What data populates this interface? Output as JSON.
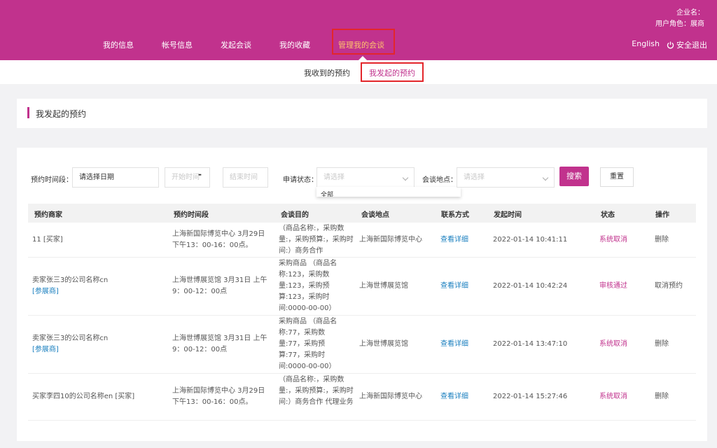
{
  "header": {
    "company_label": "企业名：",
    "role_label": "用户角色：展商",
    "nav": [
      {
        "label": "我的信息"
      },
      {
        "label": "帐号信息"
      },
      {
        "label": "发起会谈"
      },
      {
        "label": "我的收藏"
      },
      {
        "label": "管理我的会谈"
      }
    ],
    "language": "English",
    "logout": "安全退出"
  },
  "subnav": {
    "received": "我收到的预约",
    "initiated": "我发起的预约"
  },
  "section": {
    "title": "我发起的预约"
  },
  "filters": {
    "period_label": "预约时间段：",
    "date_select": "请选择日期",
    "start_placeholder": "开始时间",
    "end_placeholder": "结束时间",
    "dash": "-",
    "status_label": "申请状态：",
    "status_placeholder": "请选择",
    "location_label": "会谈地点：",
    "location_placeholder": "请选择",
    "dropdown_peek": "全部",
    "search_button": "搜索",
    "reset_button": "重置"
  },
  "table": {
    "columns": [
      "预约商家",
      "预约时间段",
      "会谈目的",
      "会谈地点",
      "联系方式",
      "发起时间",
      "状态",
      "操作"
    ],
    "rows": [
      {
        "merchant": "11 [买家]",
        "merchant_tag": "",
        "period": "上海新国际博览中心 3月29日下午13：00-16：00点。",
        "purpose": "（商品名称:，采购数量:，采购预算:，采购时间:）商务合作",
        "location": "上海新国际博览中心",
        "contact": "查看详细",
        "time": "2022-01-14 10:41:11",
        "status": "系统取消",
        "action": "删除"
      },
      {
        "merchant": "卖家张三3的公司名称cn",
        "merchant_tag": "[参展商]",
        "period": "上海世博展览馆 3月31日 上午9：00-12：00点",
        "purpose": "采购商品 （商品名称:123，采购数量:123，采购预算:123，采购时间:0000-00-00）",
        "location": "上海世博展览馆",
        "contact": "查看详细",
        "time": "2022-01-14 10:42:24",
        "status": "审核通过",
        "action": "取消预约"
      },
      {
        "merchant": "卖家张三3的公司名称cn",
        "merchant_tag": "[参展商]",
        "period": "上海世博展览馆 3月31日 上午9：00-12：00点",
        "purpose": "采购商品 （商品名称:77，采购数量:77，采购预算:77，采购时间:0000-00-00）",
        "location": "上海世博展览馆",
        "contact": "查看详细",
        "time": "2022-01-14 13:47:10",
        "status": "系统取消",
        "action": "删除"
      },
      {
        "merchant": "买家李四10的公司名称en [买家]",
        "merchant_tag": "",
        "period": "上海新国际博览中心 3月29日下午13：00-16：00点。",
        "purpose": "（商品名称:，采购数量:，采购预算:，采购时间:）商务合作 代理业务",
        "location": "上海新国际博览中心",
        "contact": "查看详细",
        "time": "2022-01-14 15:27:46",
        "status": "系统取消",
        "action": "删除"
      }
    ]
  },
  "colors": {
    "brand": "#c1328d",
    "highlight": "#e3262b",
    "link": "#1a7fbf",
    "active_nav": "#ffc36d"
  }
}
